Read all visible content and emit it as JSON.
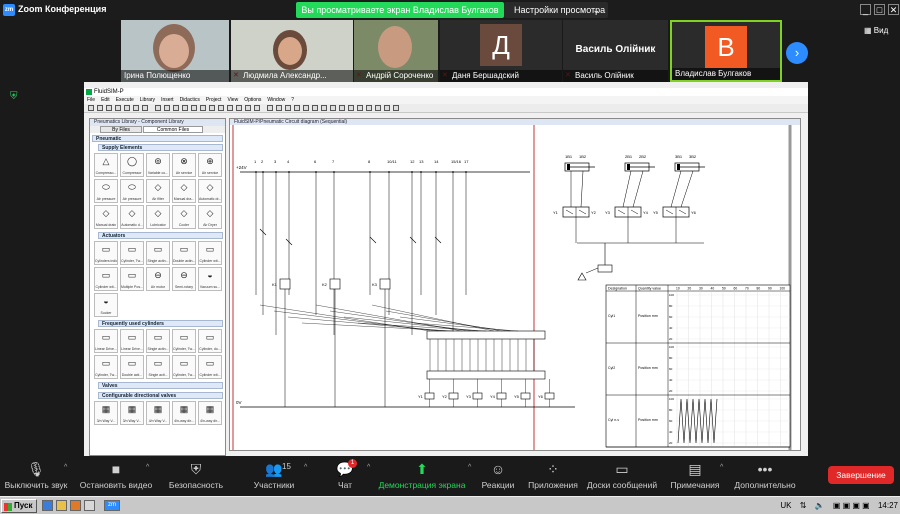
{
  "window": {
    "title": "Zoom Конференция",
    "share_banner": "Вы просматриваете экран Владислав Булгаков",
    "view_settings": "Настройки просмотра",
    "view_button": "Вид"
  },
  "participants": [
    {
      "name": "Ірина Полющенко",
      "type": "video",
      "muted": false
    },
    {
      "name": "Людмила Александр...",
      "type": "video",
      "muted": true
    },
    {
      "name": "Андрій Сороченко",
      "type": "video",
      "muted": true
    },
    {
      "name": "Даня Бершадский",
      "type": "avatar",
      "letter": "Д",
      "color": "#6b4a3e",
      "muted": true
    },
    {
      "name": "Василь Олійник",
      "type": "name",
      "big_name": "Василь Олійник",
      "muted": true
    },
    {
      "name": "Владислав Булгаков",
      "type": "avatar",
      "letter": "В",
      "color": "#f25a23",
      "muted": false,
      "active": true
    }
  ],
  "shared_screen": {
    "app_title": "FluidSIM-P",
    "menu": [
      "File",
      "Edit",
      "Execute",
      "Library",
      "Insert",
      "Didactics",
      "Project",
      "View",
      "Options",
      "Window",
      "?"
    ],
    "library": {
      "title": "Pneumatics Library - Component Library",
      "tabs": [
        "By Files",
        "Common Files"
      ],
      "root": "Pneumatic",
      "sections": [
        {
          "name": "Supply Elements",
          "items": [
            {
              "glyph": "△",
              "label": "Compresso..."
            },
            {
              "glyph": "◯",
              "label": "Compressor"
            },
            {
              "glyph": "⊚",
              "label": "Variable co..."
            },
            {
              "glyph": "⊗",
              "label": "Air service"
            },
            {
              "glyph": "⊕",
              "label": "Air service"
            },
            {
              "glyph": "⬭",
              "label": "Air pressure"
            },
            {
              "glyph": "⬭",
              "label": "Air pressure"
            },
            {
              "glyph": "◇",
              "label": "Air filter"
            },
            {
              "glyph": "◇",
              "label": "Manual dra..."
            },
            {
              "glyph": "◇",
              "label": "Automatic dr..."
            },
            {
              "glyph": "◇",
              "label": "Manual drain"
            },
            {
              "glyph": "◇",
              "label": "Automatic d..."
            },
            {
              "glyph": "◇",
              "label": "Lubricator"
            },
            {
              "glyph": "◇",
              "label": "Cooler"
            },
            {
              "glyph": "◇",
              "label": "Air Dryer"
            }
          ]
        },
        {
          "name": "Actuators",
          "items": [
            {
              "glyph": "▭",
              "label": "Cylinders indic..."
            },
            {
              "glyph": "▭",
              "label": "Cylinder, Tw..."
            },
            {
              "glyph": "▭",
              "label": "Single actin..."
            },
            {
              "glyph": "▭",
              "label": "Double actin..."
            },
            {
              "glyph": "▭",
              "label": "Cylinder wit..."
            },
            {
              "glyph": "▭",
              "label": "Cylinder wit..."
            },
            {
              "glyph": "▭",
              "label": "Multiple Pos..."
            },
            {
              "glyph": "⊖",
              "label": "Air motor"
            },
            {
              "glyph": "⊖",
              "label": "Semi-rotary"
            },
            {
              "glyph": "◒",
              "label": "Vacuum su..."
            },
            {
              "glyph": "◒",
              "label": "Sucker"
            }
          ]
        },
        {
          "name": "Frequently used cylinders",
          "items": [
            {
              "glyph": "▭",
              "label": "Linear Drive..."
            },
            {
              "glyph": "▭",
              "label": "Linear Drive..."
            },
            {
              "glyph": "▭",
              "label": "Single actin..."
            },
            {
              "glyph": "▭",
              "label": "Cylinder, Tw..."
            },
            {
              "glyph": "▭",
              "label": "Cylinder, do..."
            },
            {
              "glyph": "▭",
              "label": "Cylinder, Tw..."
            },
            {
              "glyph": "▭",
              "label": "Double acti..."
            },
            {
              "glyph": "▭",
              "label": "Single acti..."
            },
            {
              "glyph": "▭",
              "label": "Cylinder, Tw..."
            },
            {
              "glyph": "▭",
              "label": "Cylinder wit..."
            }
          ]
        },
        {
          "name": "Valves",
          "items": []
        },
        {
          "name": "Configurable directional valves",
          "items": [
            {
              "glyph": "▦",
              "label": "3/n Way V..."
            },
            {
              "glyph": "▦",
              "label": "3/n Way V..."
            },
            {
              "glyph": "▦",
              "label": "4/n Way V..."
            },
            {
              "glyph": "▦",
              "label": "4/n-way dir..."
            },
            {
              "glyph": "▦",
              "label": "4/n-way dir..."
            }
          ]
        }
      ]
    },
    "circuit": {
      "title": "FluidSIM-P/Pneumatic Circuit diagram (Sequential)",
      "supply_label": "+24V",
      "ground_label": "0V",
      "column_numbers": [
        "1",
        "2",
        "3",
        "4",
        "6",
        "7",
        "8",
        "10/11",
        "12",
        "13",
        "14",
        "15/16",
        "17"
      ],
      "cylinder_labels": [
        "1B1",
        "1B2",
        "2B1",
        "2B2",
        "3B1",
        "3B2"
      ],
      "valve_labels": [
        "Y1",
        "Y2",
        "Y3",
        "Y4",
        "Y5",
        "Y6"
      ],
      "relay_labels": [
        "K1",
        "K2",
        "K3"
      ],
      "timer_label": "T1",
      "diagram_headers": [
        "Designation",
        "Quantity value"
      ],
      "diagram_rows": [
        {
          "designation": "Cyl1",
          "quantity": "Position mm"
        },
        {
          "designation": "Cyl2",
          "quantity": "Position mm"
        },
        {
          "designation": "Cyl n-v",
          "quantity": "Position mm"
        }
      ],
      "diagram_ticks": [
        "10",
        "20",
        "30",
        "40",
        "50",
        "60",
        "70",
        "80",
        "90",
        "100"
      ],
      "diagram_scale": [
        "100",
        "80",
        "60",
        "40",
        "20"
      ]
    }
  },
  "controls": {
    "mute": "Выключить звук",
    "video": "Остановить видео",
    "security": "Безопасность",
    "participants": "Участники",
    "participants_count": "15",
    "chat": "Чат",
    "chat_badge": "1",
    "share": "Демонстрация экрана",
    "reactions": "Реакции",
    "apps": "Приложения",
    "whiteboards": "Доски сообщений",
    "notes": "Примечания",
    "more": "Дополнительно",
    "end": "Завершение"
  },
  "taskbar": {
    "start": "Пуск",
    "language": "UK",
    "time": "14:27"
  },
  "colors": {
    "share_green": "#23d959",
    "end_red": "#e02828",
    "zoom_blue": "#2d8cff",
    "wire_red": "#b00000"
  }
}
